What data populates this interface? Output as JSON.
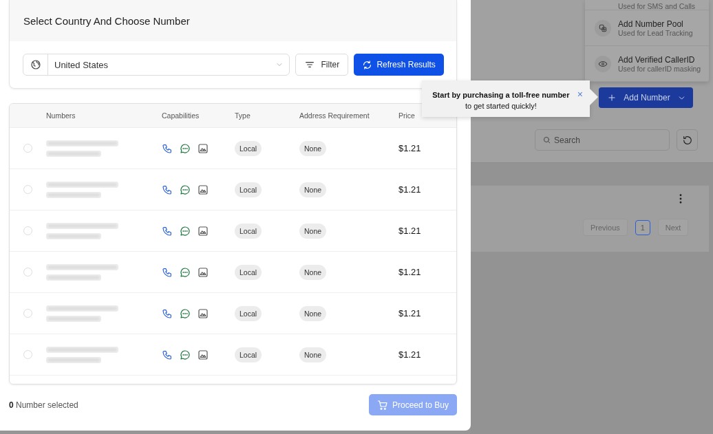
{
  "modal": {
    "title": "Select Country And Choose Number",
    "country": {
      "value": "United States"
    },
    "filter_button": "Filter",
    "refresh_button": "Refresh Results",
    "table": {
      "columns": [
        "Numbers",
        "Capabilities",
        "Type",
        "Address Requirement",
        "Price"
      ],
      "rows": [
        {
          "selected": false,
          "type": "Local",
          "address_requirement": "None",
          "price": "$1.21"
        },
        {
          "selected": false,
          "type": "Local",
          "address_requirement": "None",
          "price": "$1.21"
        },
        {
          "selected": false,
          "type": "Local",
          "address_requirement": "None",
          "price": "$1.21"
        },
        {
          "selected": false,
          "type": "Local",
          "address_requirement": "None",
          "price": "$1.21"
        },
        {
          "selected": false,
          "type": "Local",
          "address_requirement": "None",
          "price": "$1.21"
        },
        {
          "selected": false,
          "type": "Local",
          "address_requirement": "None",
          "price": "$1.21"
        }
      ]
    },
    "footer": {
      "count": "0",
      "label": "Number selected",
      "buy_button": {
        "label": "Proceed to Buy",
        "disabled": true
      }
    }
  },
  "add_menu": {
    "items": [
      {
        "subtitle": "Used for SMS and Calls"
      },
      {
        "title": "Add Number Pool",
        "subtitle": "Used for Lead Tracking"
      },
      {
        "title": "Add Verified CallerID",
        "subtitle": "Used for callerID masking"
      }
    ]
  },
  "tooltip": {
    "line_1": "Start by purchasing a toll-free number",
    "line_2": "to get started quickly!",
    "close": "×"
  },
  "add_number_button": "Add Number",
  "search": {
    "placeholder": "Search"
  },
  "pagination": {
    "previous": "Previous",
    "pages": [
      {
        "label": "1",
        "selected": true
      }
    ],
    "next": "Next"
  }
}
